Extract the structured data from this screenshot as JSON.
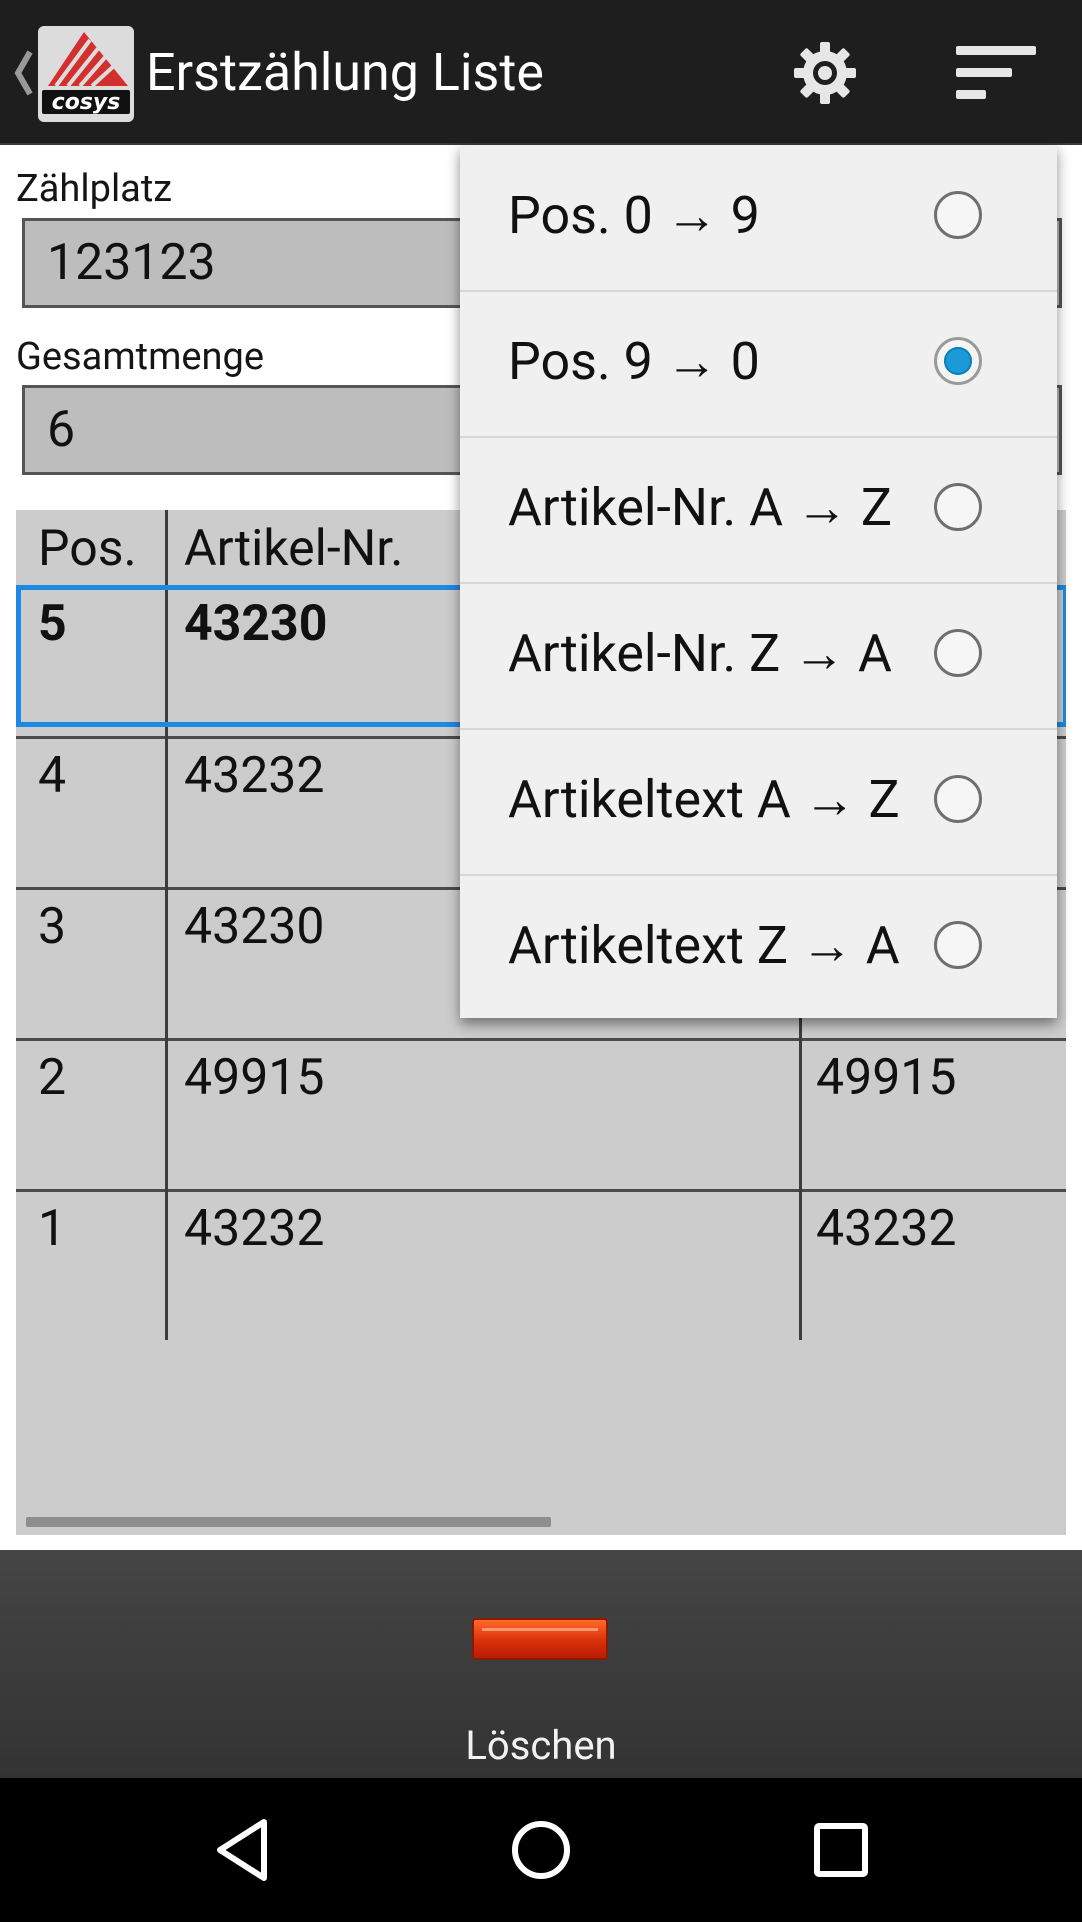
{
  "app_bar": {
    "title": "Erstzählung Liste",
    "back_icon": "chevron-left-icon",
    "logo_icon": "company-logo",
    "logo_text": "cosys",
    "settings_icon": "gear-icon",
    "sort_icon": "sort-icon"
  },
  "form": {
    "counting_place_label": "Zählplatz",
    "counting_place_value": "123123",
    "total_quantity_label": "Gesamtmenge",
    "total_quantity_value": "6"
  },
  "table": {
    "headers": [
      "Pos.",
      "Artikel-Nr.",
      ""
    ],
    "rows": [
      {
        "pos": "5",
        "artikel_nr": "43230",
        "col3": "",
        "selected": true
      },
      {
        "pos": "4",
        "artikel_nr": "43232",
        "col3": ""
      },
      {
        "pos": "3",
        "artikel_nr": "43230",
        "col3": ""
      },
      {
        "pos": "2",
        "artikel_nr": "49915",
        "col3": "49915"
      },
      {
        "pos": "1",
        "artikel_nr": "43232",
        "col3": "43232"
      }
    ]
  },
  "sort_menu": {
    "items": [
      {
        "label": "Pos. 0 → 9",
        "selected": false
      },
      {
        "label": "Pos. 9 → 0",
        "selected": true
      },
      {
        "label": "Artikel-Nr. A → Z",
        "selected": false
      },
      {
        "label": "Artikel-Nr. Z → A",
        "selected": false
      },
      {
        "label": "Artikeltext A → Z",
        "selected": false
      },
      {
        "label": "Artikeltext Z → A",
        "selected": false
      }
    ]
  },
  "bottom_bar": {
    "delete_label": "Löschen"
  },
  "colors": {
    "app_bar": "#1e1e1e",
    "selection": "#1e88e5",
    "radio_selected": "#1a9bd7",
    "delete_button": "#e0400f"
  }
}
